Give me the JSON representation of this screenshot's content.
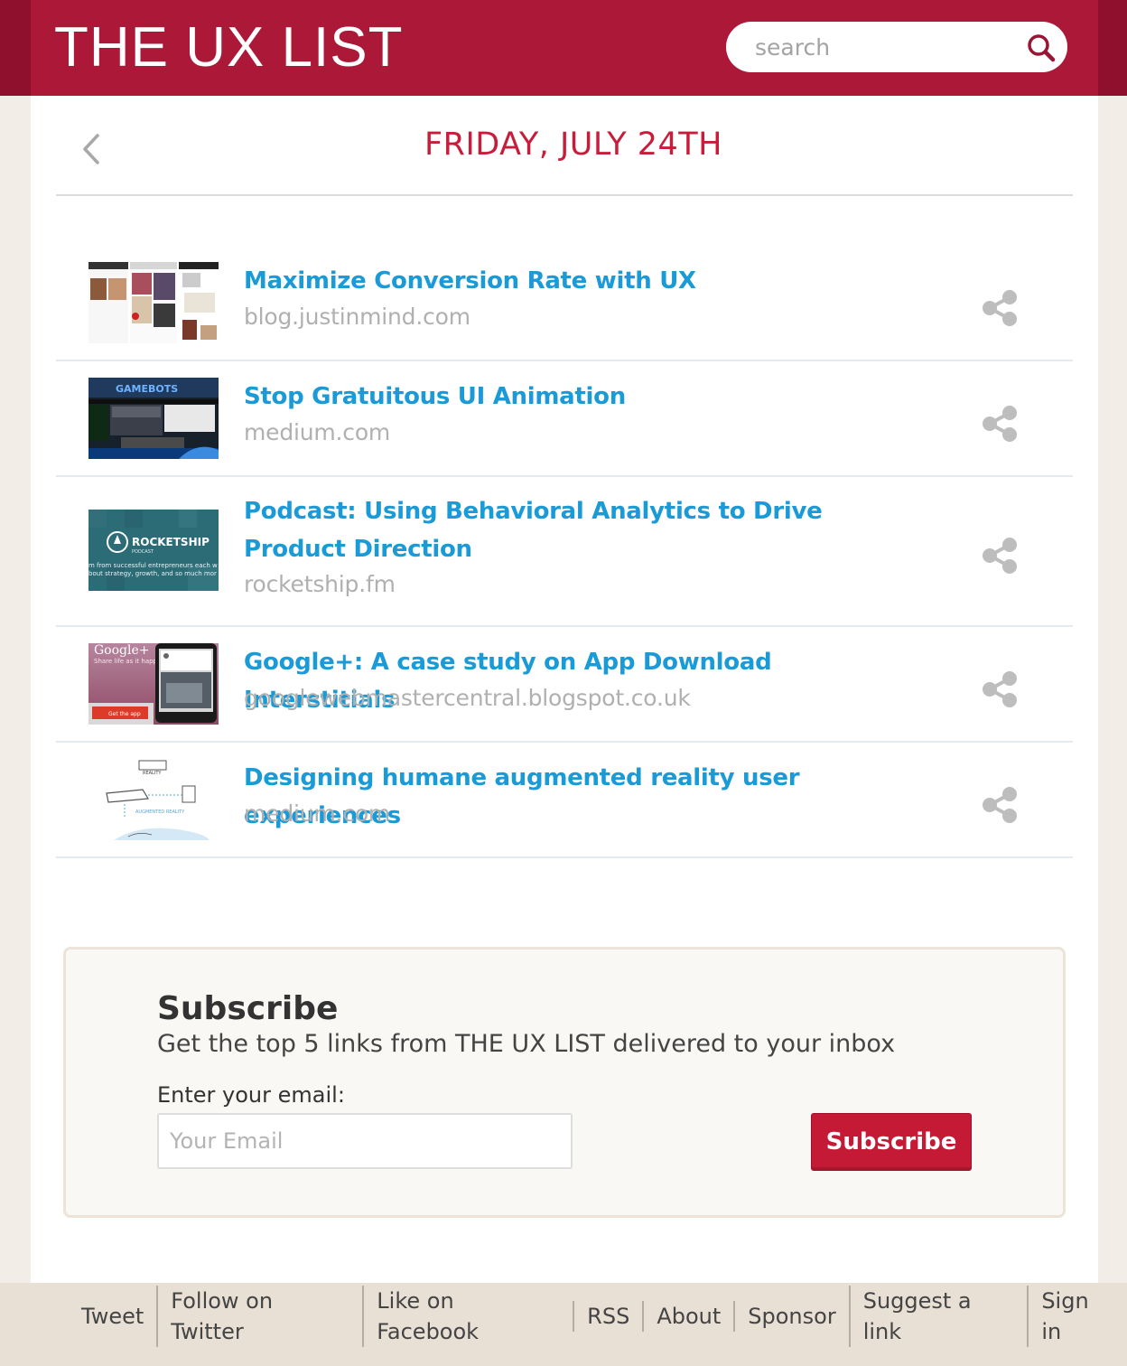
{
  "header": {
    "logo": "THE UX LIST",
    "search_placeholder": "search",
    "colors": {
      "brand": "#ab1838",
      "accent": "#c81d3a",
      "link": "#1a9ad6"
    }
  },
  "date": {
    "title": "FRIDAY, JULY 24TH"
  },
  "articles": [
    {
      "title": "Maximize Conversion Rate with UX",
      "source": "blog.justinmind.com",
      "thumb": "pinterest-screens-thumbnail"
    },
    {
      "title": "Stop Gratuitous UI Animation",
      "source": "medium.com",
      "thumb": "game-site-thumbnail"
    },
    {
      "title": "Podcast: Using Behavioral Analytics to Drive Product Direction",
      "source": "rocketship.fm",
      "thumb": "rocketship-podcast-thumbnail",
      "thumb_text": {
        "brand": "ROCKETSHIP",
        "sub": "PODCAST",
        "line1": "m from successful entrepreneurs each w",
        "line2": "bout strategy, growth, and so much mor"
      }
    },
    {
      "title": "Google+: A case study on App Download Interstitials",
      "source": "googlewebmastercentral.blogspot.co.uk",
      "thumb": "google-plus-thumbnail",
      "thumb_text": {
        "brand": "Google+",
        "tagline": "Share life as it happens",
        "button": "Get the app"
      }
    },
    {
      "title": "Designing humane augmented reality user experiences",
      "source": "medium.com",
      "thumb": "ar-sketch-thumbnail",
      "thumb_text": {
        "top": "REALITY",
        "bottom": "AUGMENTED REALITY"
      }
    }
  ],
  "subscribe": {
    "heading": "Subscribe",
    "description": "Get the top 5 links from THE UX LIST delivered to your inbox",
    "email_label": "Enter your email:",
    "email_placeholder": "Your Email",
    "button_label": "Subscribe"
  },
  "footer": {
    "links": [
      "Tweet",
      "Follow on Twitter",
      "Like on Facebook",
      "RSS",
      "About",
      "Sponsor",
      "Suggest a link",
      "Sign in"
    ]
  }
}
